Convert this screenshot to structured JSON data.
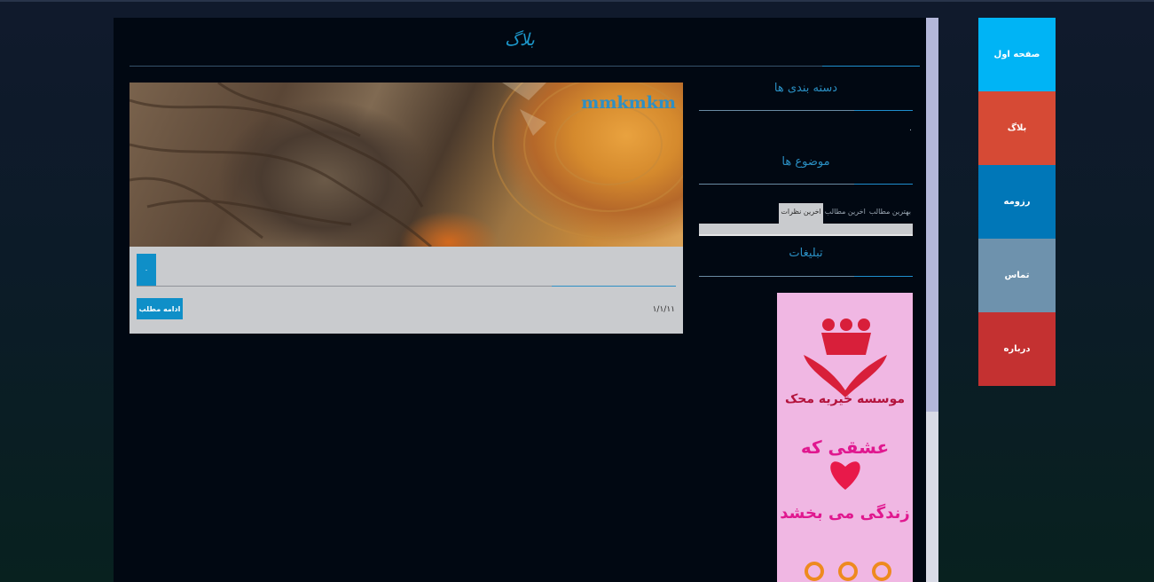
{
  "site": {
    "title": "بلاگ"
  },
  "post": {
    "title": "mmkmkm",
    "comment_count": "٠",
    "date": "١/١/١١",
    "read_more": "ادامه مطلب"
  },
  "sidebar": {
    "categories_heading": "دسته بندی ها",
    "categories_text": "٠",
    "topics_heading": "موضوع ها",
    "tabs": [
      {
        "label": "بهترین مطالب"
      },
      {
        "label": "اخرین مطالب"
      },
      {
        "label": "اخرین نظرات"
      }
    ],
    "ads_heading": "تبلیغات",
    "ad": {
      "line1": "موسسه خیریه محک",
      "line2": "عشقی که",
      "line3": "زندگی می بخشد"
    }
  },
  "nav": {
    "items": [
      {
        "label": "صفحه اول",
        "color": "#00b4f5"
      },
      {
        "label": "بلاگ",
        "color": "#d64a35"
      },
      {
        "label": "رزومه",
        "color": "#0077b8"
      },
      {
        "label": "تماس",
        "color": "#6e92ad"
      },
      {
        "label": "درباره",
        "color": "#c43131"
      }
    ]
  }
}
